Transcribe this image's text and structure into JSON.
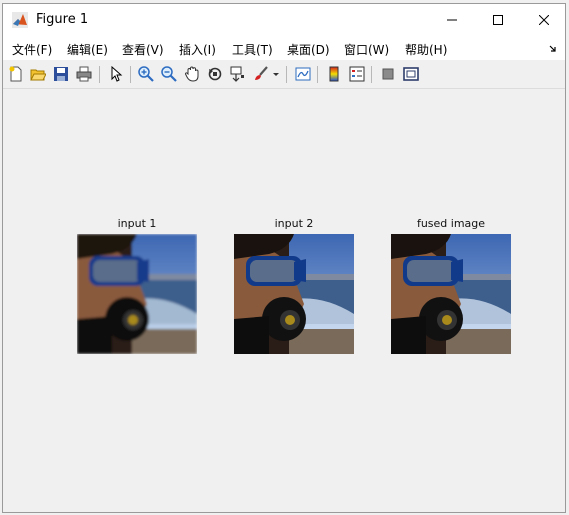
{
  "window": {
    "title": "Figure 1"
  },
  "menu": {
    "items": [
      "文件(F)",
      "编辑(E)",
      "查看(V)",
      "插入(I)",
      "工具(T)",
      "桌面(D)",
      "窗口(W)",
      "帮助(H)"
    ]
  },
  "toolbar": {
    "icons": [
      "new-figure-icon",
      "open-icon",
      "save-icon",
      "print-icon",
      "select-arrow-icon",
      "zoom-in-icon",
      "zoom-out-icon",
      "pan-hand-icon",
      "rotate-3d-icon",
      "data-cursor-icon",
      "brush-icon",
      "link-plot-icon",
      "colorbar-icon",
      "legend-icon",
      "hide-plot-tools-icon",
      "show-plot-tools-icon"
    ]
  },
  "figure": {
    "panels": [
      {
        "title": "input 1"
      },
      {
        "title": "input 2"
      },
      {
        "title": "fused image"
      }
    ]
  },
  "colors": {
    "background": "#f0f0f0",
    "titlebar": "#ffffff",
    "toolbar_blue": "#2d6cc1"
  }
}
